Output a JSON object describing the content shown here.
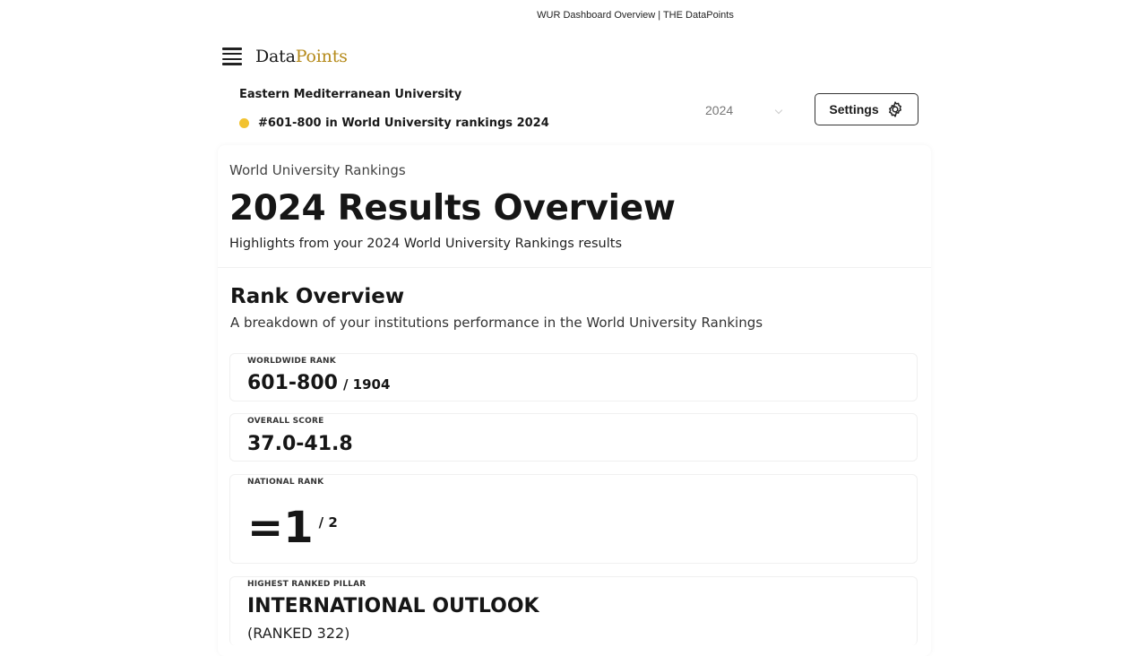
{
  "window": {
    "title": "WUR Dashboard Overview | THE DataPoints"
  },
  "header": {
    "logo_main": "Data",
    "logo_accent": "Points",
    "logo_accent_color": "#b58a1a",
    "menu_icon": "hamburger-menu-icon"
  },
  "institution": {
    "name": "Eastern Mediterranean University",
    "rank_summary": "#601-800 in World University rankings 2024",
    "status_color": "#f2c230"
  },
  "year_select": {
    "value": "2024"
  },
  "settings": {
    "label": "Settings",
    "icon": "gear-icon"
  },
  "hero": {
    "eyebrow": "World University Rankings",
    "title": "2024 Results Overview",
    "subtitle": "Highlights from your 2024 World University Rankings results"
  },
  "rank_overview": {
    "title": "Rank Overview",
    "subtitle": "A breakdown of your institutions performance in the World University Rankings",
    "worldwide": {
      "label": "WORLDWIDE RANK",
      "value": "601-800",
      "of": "/ 1904"
    },
    "overall": {
      "label": "OVERALL SCORE",
      "value": "37.0-41.8"
    },
    "national": {
      "label": "NATIONAL RANK",
      "value": "=1",
      "of": "/ 2"
    },
    "pillar": {
      "label": "HIGHEST RANKED PILLAR",
      "value": "INTERNATIONAL OUTLOOK",
      "note": "(RANKED 322)"
    }
  }
}
